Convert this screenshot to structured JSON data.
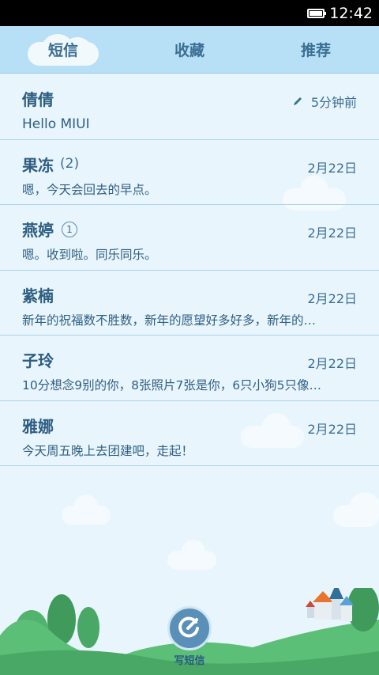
{
  "status_bar": {
    "time": "12:42",
    "battery_icon": "battery-icon"
  },
  "tabs": [
    {
      "label": "短信",
      "selected": true
    },
    {
      "label": "收藏",
      "selected": false
    },
    {
      "label": "推荐",
      "selected": false
    }
  ],
  "conversations": [
    {
      "name": "倩倩",
      "count": "",
      "unread": "",
      "date": "5分钟前",
      "draft_icon": "pencil-icon",
      "preview": "Hello MIUI"
    },
    {
      "name": "果冻",
      "count": "(2)",
      "unread": "",
      "date": "2月22日",
      "preview": "嗯，今天会回去的早点。"
    },
    {
      "name": "燕婷",
      "count": "",
      "unread": "1",
      "date": "2月22日",
      "preview": "嗯。收到啦。同乐同乐。"
    },
    {
      "name": "紫楠",
      "count": "",
      "unread": "",
      "date": "2月22日",
      "preview": "新年的祝福数不胜数，新年的愿望好多好多，新年的…"
    },
    {
      "name": "子玲",
      "count": "",
      "unread": "",
      "date": "2月22日",
      "preview": "10分想念9别的你，8张照片7张是你，6只小狗5只像…"
    },
    {
      "name": "雅娜",
      "count": "",
      "unread": "",
      "date": "2月22日",
      "preview": "今天周五晚上去团建吧，走起！"
    }
  ],
  "compose": {
    "label": "写短信",
    "icon": "compose-icon"
  },
  "colors": {
    "accent": "#5a8fb8",
    "background": "#e8f5fc",
    "tab_bar": "#b7dff5",
    "text": "#2d5d80"
  }
}
